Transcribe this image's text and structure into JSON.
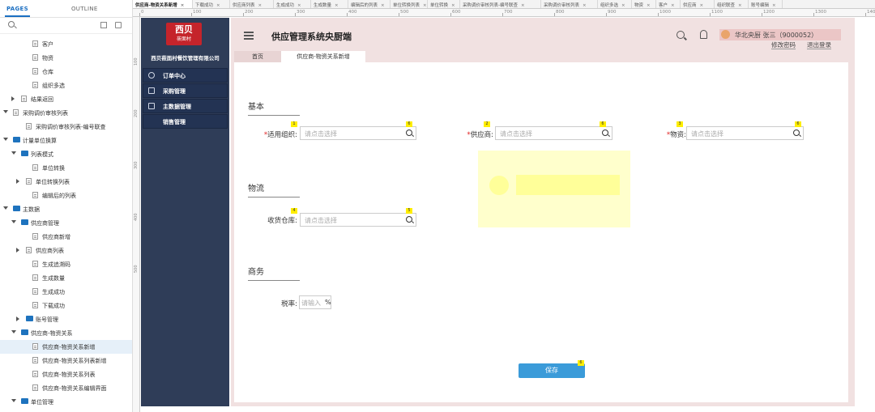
{
  "left_panel": {
    "tab_pages": "PAGES",
    "tab_outline": "OUTLINE",
    "tree": [
      {
        "label": "客户",
        "kind": "page"
      },
      {
        "label": "物资",
        "kind": "page"
      },
      {
        "label": "仓库",
        "kind": "page"
      },
      {
        "label": "组织多选",
        "kind": "page"
      },
      {
        "label": "结果返回",
        "kind": "page"
      },
      {
        "label": "采购调价审核列表",
        "kind": "page"
      },
      {
        "label": "采购调价审核列表-编号联查",
        "kind": "page"
      },
      {
        "label": "计量单位换算",
        "kind": "folder"
      },
      {
        "label": "列表模式",
        "kind": "folder"
      },
      {
        "label": "单位转换",
        "kind": "page"
      },
      {
        "label": "单位转换列表",
        "kind": "page"
      },
      {
        "label": "编辑后的列表",
        "kind": "page"
      },
      {
        "label": "主数据",
        "kind": "folder"
      },
      {
        "label": "供应商管理",
        "kind": "folder"
      },
      {
        "label": "供应商新增",
        "kind": "page"
      },
      {
        "label": "供应商列表",
        "kind": "page"
      },
      {
        "label": "生成追溯码",
        "kind": "page"
      },
      {
        "label": "生成数量",
        "kind": "page"
      },
      {
        "label": "生成成功",
        "kind": "page"
      },
      {
        "label": "下载成功",
        "kind": "page"
      },
      {
        "label": "账号管理",
        "kind": "folder"
      },
      {
        "label": "供应商-物资关系",
        "kind": "folder"
      },
      {
        "label": "供应商-物资关系新增",
        "kind": "page"
      },
      {
        "label": "供应商-物资关系列表新增",
        "kind": "page"
      },
      {
        "label": "供应商-物资关系列表",
        "kind": "page"
      },
      {
        "label": "供应商-物资关系编辑界面",
        "kind": "page"
      },
      {
        "label": "单位管理",
        "kind": "folder"
      }
    ]
  },
  "doc_tabs": [
    "供应商-物资关系新增",
    "下载成功",
    "供应商列表",
    "生成成功",
    "生成数量",
    "编辑后的列表",
    "单位转换列表",
    "单位转换",
    "采购调价审核列表-编号联查",
    "采购调价审核列表",
    "组织多选",
    "物资",
    "客户",
    "供应商",
    "组织联查",
    "账号编辑"
  ],
  "ruler": [
    "0",
    "100",
    "200",
    "300",
    "400",
    "500",
    "600",
    "700",
    "800",
    "900",
    "1000",
    "1100",
    "1200",
    "1300",
    "1400"
  ],
  "vruler": [
    "100",
    "200",
    "300",
    "400",
    "500"
  ],
  "app": {
    "logo_big": "西贝",
    "logo_small": "莜面村",
    "company": "西贝莜面村餐饮管理有限公司",
    "menu": [
      "订单中心",
      "采购管理",
      "主数据管理",
      "销售管理"
    ],
    "title": "供应管理系统央厨端",
    "user": "华北央厨 张三（9000052）",
    "change_password": "修改密码",
    "logout": "退出登录",
    "page_tabs": [
      "首页",
      "供应商-物资关系新增"
    ],
    "sections": {
      "basic": "基本",
      "logistics": "物流",
      "business": "商务"
    },
    "fields": {
      "org_label": "适用组织:",
      "supplier_label": "供应商:",
      "material_label": "物资:",
      "warehouse_label": "收货仓库:",
      "tax_label": "税率:",
      "placeholder": "请点击选择",
      "tax_placeholder": "请输入",
      "tax_unit": "%"
    },
    "markers": [
      "1",
      "6",
      "2",
      "6",
      "3",
      "6",
      "4",
      "5",
      "6"
    ],
    "save": "保存",
    "colors": {
      "sidebar": "#2f3d58",
      "header_bg": "#f1e1e1",
      "save": "#3b9bd9",
      "logo": "#c5242b"
    }
  }
}
